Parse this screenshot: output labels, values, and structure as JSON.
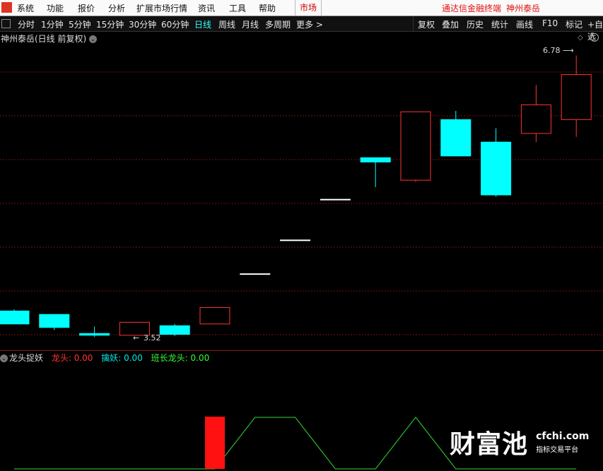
{
  "menubar": {
    "items": [
      "系统",
      "功能",
      "报价",
      "分析",
      "扩展市场行情",
      "资讯",
      "工具",
      "帮助"
    ],
    "market": "市场",
    "brand_left": "通达信金融终端",
    "brand_right": "神州泰岳"
  },
  "toolbar": {
    "periods": [
      "分时",
      "1分钟",
      "5分钟",
      "15分钟",
      "30分钟",
      "60分钟",
      "日线",
      "周线",
      "月线",
      "多周期",
      "更多 >"
    ],
    "active": "日线",
    "right_buttons": [
      "复权",
      "叠加",
      "历史",
      "统计",
      "画线",
      "F10",
      "标记",
      "+自选"
    ]
  },
  "chart": {
    "title": "神州泰岳(日线 前复权)",
    "high_label": "6.78",
    "low_label": "3.52",
    "colors": {
      "up": "#ff3333",
      "down": "#00ffff",
      "flat": "#ffffff",
      "grid": "#7a1010"
    },
    "candles": [
      {
        "o": 3.83,
        "c": 3.68,
        "h": 3.85,
        "l": 3.68
      },
      {
        "o": 3.79,
        "c": 3.64,
        "h": 3.79,
        "l": 3.61
      },
      {
        "o": 3.57,
        "c": 3.55,
        "h": 3.65,
        "l": 3.53
      },
      {
        "o": 3.55,
        "c": 3.7,
        "h": 3.7,
        "l": 3.55
      },
      {
        "o": 3.66,
        "c": 3.56,
        "h": 3.68,
        "l": 3.54
      },
      {
        "o": 3.68,
        "c": 3.87,
        "h": 3.87,
        "l": 3.68
      },
      {
        "o": 4.26,
        "c": 4.26,
        "h": 4.26,
        "l": 4.26
      },
      {
        "o": 4.65,
        "c": 4.65,
        "h": 4.65,
        "l": 4.65
      },
      {
        "o": 5.12,
        "c": 5.12,
        "h": 5.12,
        "l": 5.12
      },
      {
        "o": 5.6,
        "c": 5.55,
        "h": 5.6,
        "l": 5.26
      },
      {
        "o": 5.34,
        "c": 6.13,
        "h": 6.13,
        "l": 5.32
      },
      {
        "o": 6.04,
        "c": 5.62,
        "h": 6.14,
        "l": 5.62
      },
      {
        "o": 5.78,
        "c": 5.17,
        "h": 5.94,
        "l": 5.15
      },
      {
        "o": 5.88,
        "c": 6.21,
        "h": 6.44,
        "l": 5.78
      },
      {
        "o": 6.04,
        "c": 6.56,
        "h": 6.78,
        "l": 5.84
      }
    ],
    "ylim": [
      3.45,
      6.85
    ]
  },
  "indicator": {
    "name": "龙头捉妖",
    "fields": [
      {
        "label": "龙头: 0.00",
        "color": "#ff3333"
      },
      {
        "label": "擒妖: 0.00",
        "color": "#00e5e5"
      },
      {
        "label": "班长龙头: 0.00",
        "color": "#33ff33"
      }
    ],
    "green_line": [
      0,
      0,
      0,
      0,
      0,
      0,
      1,
      1,
      0,
      0,
      1,
      0,
      0,
      0,
      0
    ],
    "red_bar_index": 5
  },
  "watermark": {
    "cn": "财富池",
    "domain": "cfchi.com",
    "slogan": "指标交易平台"
  }
}
